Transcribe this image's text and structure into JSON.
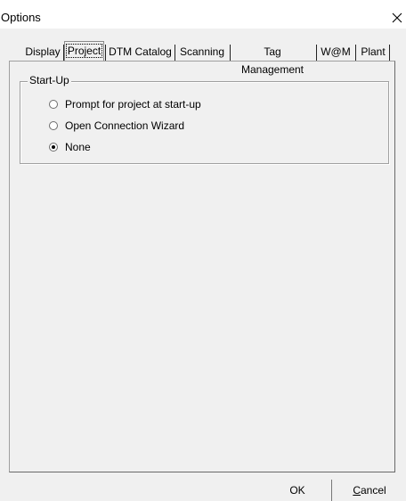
{
  "window": {
    "title": "Options",
    "close_glyph": "✕"
  },
  "tabs": [
    {
      "label": "Display",
      "active": false
    },
    {
      "label": "Project",
      "active": true
    },
    {
      "label": "DTM Catalog",
      "active": false
    },
    {
      "label": "Scanning",
      "active": false
    },
    {
      "label": "Tag Management",
      "active": false
    },
    {
      "label": "W@M",
      "active": false
    },
    {
      "label": "Plant",
      "active": false
    }
  ],
  "startup_group": {
    "legend": "Start-Up",
    "options": [
      {
        "label": "Prompt for project at start-up",
        "checked": false
      },
      {
        "label": "Open Connection Wizard",
        "checked": false
      },
      {
        "label": "None",
        "checked": true
      }
    ]
  },
  "buttons": {
    "ok": "OK",
    "cancel_first": "C",
    "cancel_rest": "ancel"
  },
  "colors": {
    "face": "#f0f0f0",
    "border": "#a0a0a0"
  }
}
